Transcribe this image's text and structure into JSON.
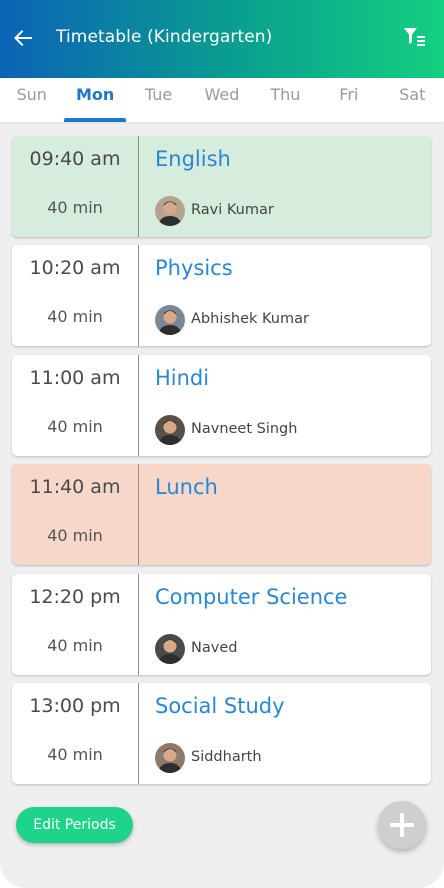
{
  "header": {
    "title": "Timetable (Kindergarten)",
    "back_icon": "arrow-left-icon",
    "filter_icon": "filter-list-icon"
  },
  "days": {
    "selected": "Mon",
    "items": [
      "Sun",
      "Mon",
      "Tue",
      "Wed",
      "Thu",
      "Fri",
      "Sat"
    ]
  },
  "periods": [
    {
      "time": "09:40 am",
      "duration": "40 min",
      "subject": "English",
      "teacher": "Ravi Kumar",
      "bg": "#d6ecdc"
    },
    {
      "time": "10:20 am",
      "duration": "40 min",
      "subject": "Physics",
      "teacher": "Abhishek Kumar",
      "bg": "#ffffff"
    },
    {
      "time": "11:00 am",
      "duration": "40 min",
      "subject": "Hindi",
      "teacher": "Navneet Singh",
      "bg": "#ffffff"
    },
    {
      "time": "11:40 am",
      "duration": "40 min",
      "subject": "Lunch",
      "teacher": "",
      "bg": "#f6d7c9"
    },
    {
      "time": "12:20 pm",
      "duration": "40 min",
      "subject": "Computer Science",
      "teacher": "Naved",
      "bg": "#ffffff"
    },
    {
      "time": "13:00 pm",
      "duration": "40 min",
      "subject": "Social Study",
      "teacher": "Siddharth",
      "bg": "#ffffff"
    }
  ],
  "actions": {
    "edit_label": "Edit Periods",
    "add_icon": "plus-icon"
  },
  "colors": {
    "accent": "#1f77c7",
    "subject": "#2a86d4",
    "edit_button": "#1ed38a"
  }
}
